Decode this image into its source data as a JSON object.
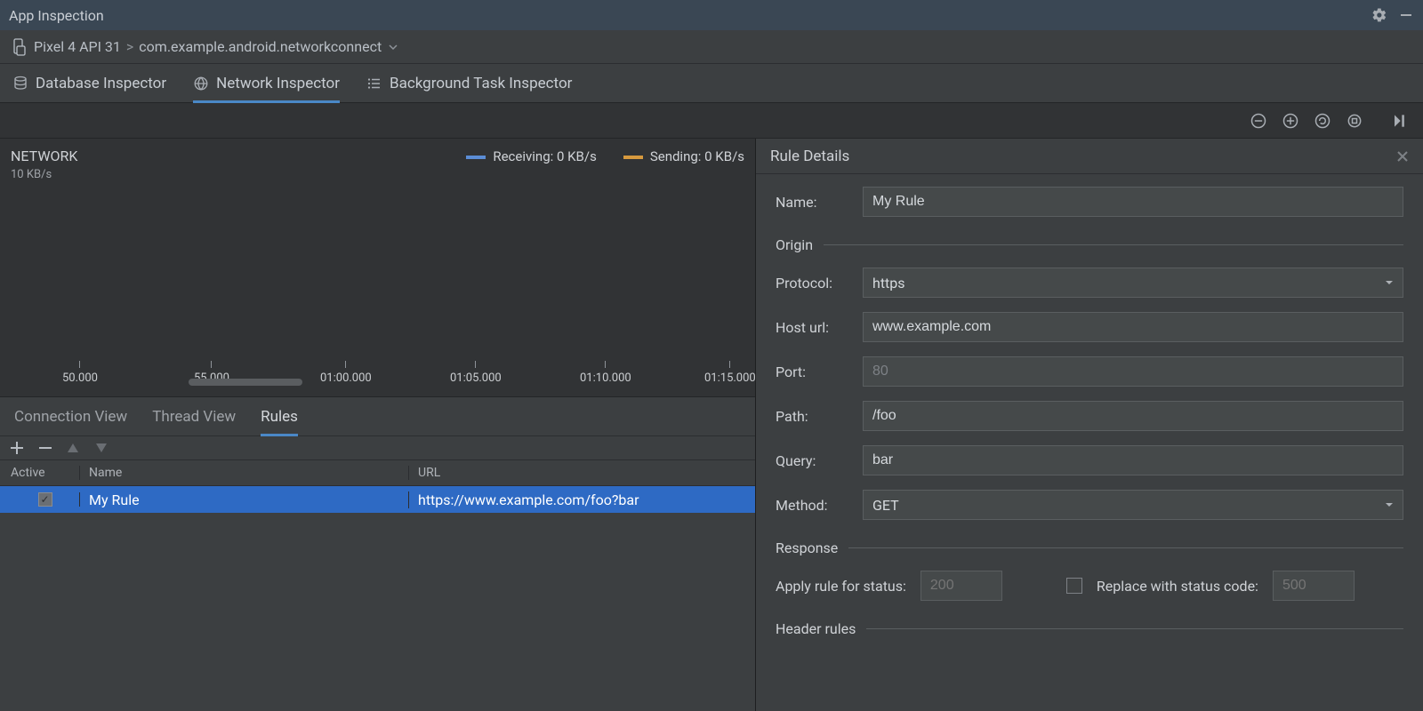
{
  "titlebar": {
    "title": "App Inspection"
  },
  "breadcrumb": {
    "device": "Pixel 4 API 31",
    "separator": ">",
    "app": "com.example.android.networkconnect"
  },
  "inspectorTabs": {
    "database": "Database Inspector",
    "network": "Network Inspector",
    "background": "Background Task Inspector",
    "active": "network"
  },
  "network": {
    "title": "NETWORK",
    "axis_label": "10 KB/s",
    "legend": {
      "receiving_label": "Receiving:",
      "receiving_value": "0 KB/s",
      "sending_label": "Sending:",
      "sending_value": "0 KB/s"
    },
    "timeline_ticks": [
      "50.000",
      "55.000",
      "01:00.000",
      "01:05.000",
      "01:10.000",
      "01:15.000"
    ]
  },
  "subtabs": {
    "connection": "Connection View",
    "thread": "Thread View",
    "rules": "Rules",
    "active": "rules"
  },
  "rulesTable": {
    "headers": {
      "active": "Active",
      "name": "Name",
      "url": "URL"
    },
    "rows": [
      {
        "active": true,
        "name": "My Rule",
        "url": "https://www.example.com/foo?bar",
        "selected": true
      }
    ]
  },
  "details": {
    "title": "Rule Details",
    "name_label": "Name:",
    "name_value": "My Rule",
    "origin_heading": "Origin",
    "protocol_label": "Protocol:",
    "protocol_value": "https",
    "host_label": "Host url:",
    "host_value": "www.example.com",
    "port_label": "Port:",
    "port_placeholder": "80",
    "path_label": "Path:",
    "path_value": "/foo",
    "query_label": "Query:",
    "query_value": "bar",
    "method_label": "Method:",
    "method_value": "GET",
    "response_heading": "Response",
    "apply_status_label": "Apply rule for status:",
    "apply_status_placeholder": "200",
    "replace_label": "Replace with status code:",
    "replace_placeholder": "500",
    "header_rules_heading": "Header rules"
  }
}
